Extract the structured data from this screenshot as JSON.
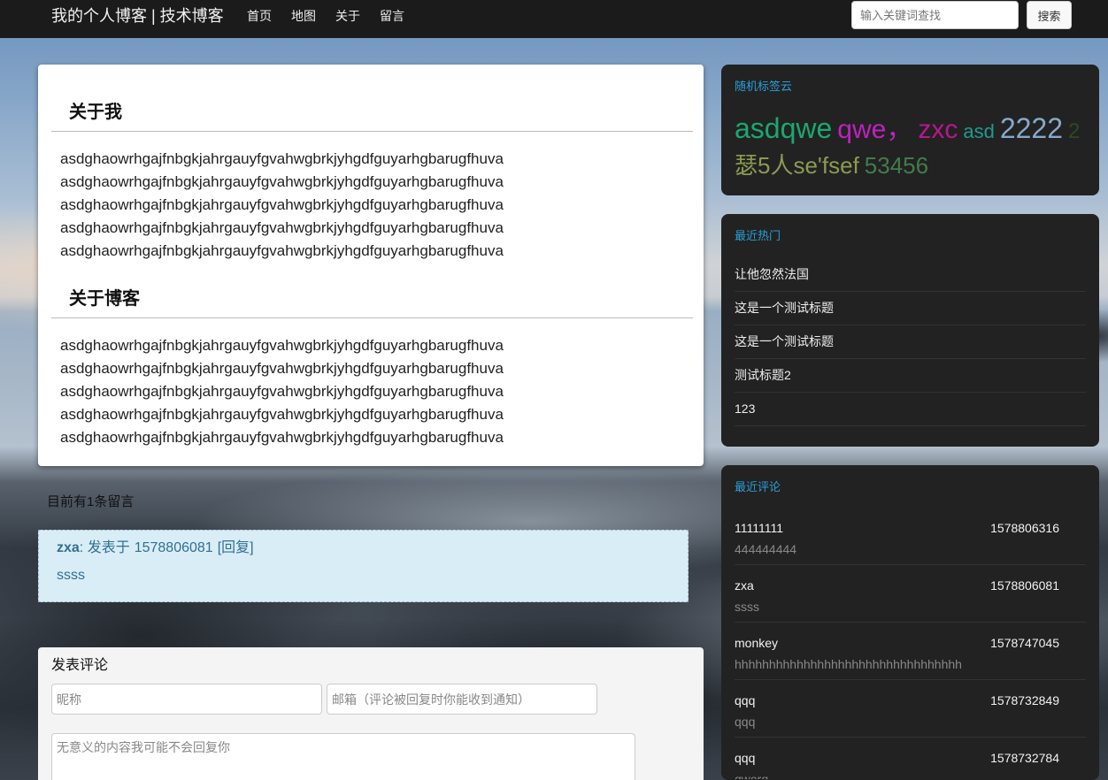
{
  "navbar": {
    "brand": "我的个人博客 | 技术博客",
    "links": [
      "首页",
      "地图",
      "关于",
      "留言"
    ],
    "search_placeholder": "输入关键词查找",
    "search_button": "搜索"
  },
  "about": {
    "sections": [
      {
        "heading": "关于我",
        "lines": [
          "asdghaowrhgajfnbgkjahrgauyfgvahwgbrkjyhgdfguyarhgbarugfhuva",
          "asdghaowrhgajfnbgkjahrgauyfgvahwgbrkjyhgdfguyarhgbarugfhuva",
          "asdghaowrhgajfnbgkjahrgauyfgvahwgbrkjyhgdfguyarhgbarugfhuva",
          "asdghaowrhgajfnbgkjahrgauyfgvahwgbrkjyhgdfguyarhgbarugfhuva",
          "asdghaowrhgajfnbgkjahrgauyfgvahwgbrkjyhgdfguyarhgbarugfhuva"
        ]
      },
      {
        "heading": "关于博客",
        "lines": [
          "asdghaowrhgajfnbgkjahrgauyfgvahwgbrkjyhgdfguyarhgbarugfhuva",
          "asdghaowrhgajfnbgkjahrgauyfgvahwgbrkjyhgdfguyarhgbarugfhuva",
          "asdghaowrhgajfnbgkjahrgauyfgvahwgbrkjyhgdfguyarhgbarugfhuva",
          "asdghaowrhgajfnbgkjahrgauyfgvahwgbrkjyhgdfguyarhgbarugfhuva",
          "asdghaowrhgajfnbgkjahrgauyfgvahwgbrkjyhgdfguyarhgbarugfhuva"
        ]
      }
    ]
  },
  "comments": {
    "count_text": "目前有1条留言",
    "items": [
      {
        "author": "zxa",
        "posted_prefix": ": 发表于",
        "time": "1578806081",
        "reply": "[回复]",
        "body": "ssss"
      }
    ]
  },
  "comment_form": {
    "title": "发表评论",
    "nickname_placeholder": "昵称",
    "email_placeholder": "邮箱（评论被回复时你能收到通知）",
    "content_placeholder": "无意义的内容我可能不会回复你"
  },
  "sidebar": {
    "tag_cloud": {
      "title": "随机标签云",
      "tags": [
        {
          "text": "asdqwe",
          "color": "#1ba86f"
        },
        {
          "text": "qwe，",
          "color": "#c020c0"
        },
        {
          "text": "zxc",
          "color": "#b8168f"
        },
        {
          "text": "asd",
          "color": "#22998e"
        },
        {
          "text": "2222",
          "color": "#86a9c9"
        },
        {
          "text": "2",
          "color": "#2e4a22"
        },
        {
          "text": "瑟5人se'fsef",
          "color": "#8c9a52"
        },
        {
          "text": "53456",
          "color": "#437b4c"
        }
      ]
    },
    "hot": {
      "title": "最近热门",
      "items": [
        "让他忽然法国",
        "这是一个测试标题",
        "这是一个测试标题",
        "测试标题2",
        "123"
      ]
    },
    "recent_comments": {
      "title": "最近评论",
      "items": [
        {
          "author": "11111111",
          "time": "1578806316",
          "body": "444444444"
        },
        {
          "author": "zxa",
          "time": "1578806081",
          "body": "ssss"
        },
        {
          "author": "monkey",
          "time": "1578747045",
          "body": "hhhhhhhhhhhhhhhhhhhhhhhhhhhhhhhhh"
        },
        {
          "author": "qqq",
          "time": "1578732849",
          "body": "qqq"
        },
        {
          "author": "qqq",
          "time": "1578732784",
          "body": "qwerq"
        }
      ]
    }
  },
  "colors": {
    "accent": "#2a9fd6",
    "navbar_bg": "#1b1b1b",
    "panel_bg": "#222222",
    "comment_bg": "#d9edf7",
    "comment_text": "#31708f"
  }
}
